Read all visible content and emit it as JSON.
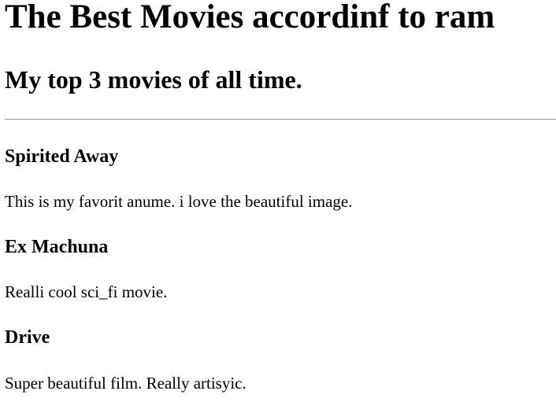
{
  "header": {
    "title": "The Best Movies accordinf to ram",
    "subtitle": "My top 3 movies of all time."
  },
  "movies": [
    {
      "title": "Spirited Away",
      "description": "This is my favorit anume. i love the beautiful image."
    },
    {
      "title": "Ex Machuna",
      "description": "Realli cool sci_fi movie."
    },
    {
      "title": "Drive",
      "description": "Super beautiful film. Really artisyic."
    }
  ]
}
